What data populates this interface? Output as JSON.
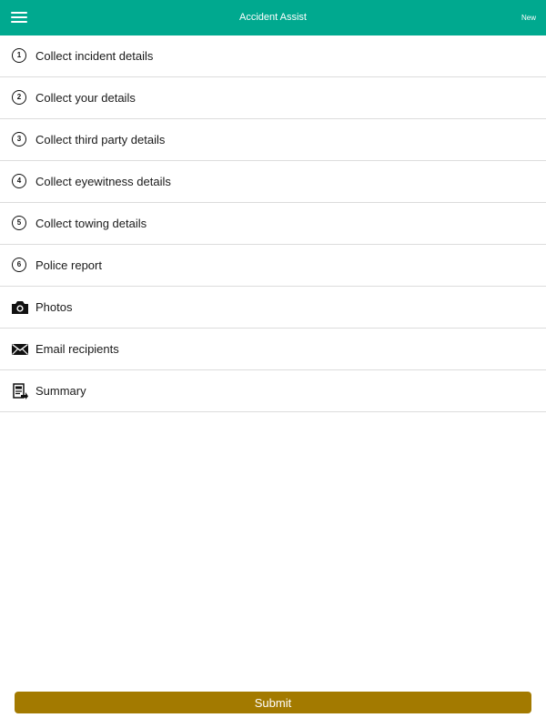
{
  "header": {
    "title": "Accident Assist",
    "new_label": "New",
    "background_color": "#00a98f"
  },
  "menu": {
    "items": [
      {
        "number": "1",
        "label": "Collect incident details",
        "icon": "number-1-icon"
      },
      {
        "number": "2",
        "label": "Collect your details",
        "icon": "number-2-icon"
      },
      {
        "number": "3",
        "label": "Collect third party details",
        "icon": "number-3-icon"
      },
      {
        "number": "4",
        "label": "Collect eyewitness details",
        "icon": "number-4-icon"
      },
      {
        "number": "5",
        "label": "Collect towing details",
        "icon": "number-5-icon"
      },
      {
        "number": "6",
        "label": "Police report",
        "icon": "number-6-icon"
      },
      {
        "label": "Photos",
        "icon": "camera-icon"
      },
      {
        "label": "Email recipients",
        "icon": "envelope-icon"
      },
      {
        "label": "Summary",
        "icon": "document-icon"
      }
    ]
  },
  "footer": {
    "submit_label": "Submit",
    "submit_color": "#a37a00"
  }
}
